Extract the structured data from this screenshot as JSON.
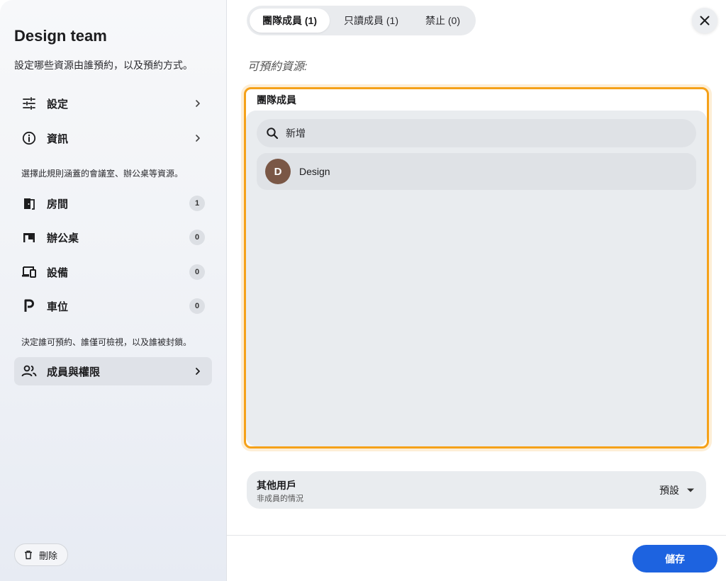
{
  "sidebar": {
    "title": "Design team",
    "subtitle": "設定哪些資源由誰預約，以及預約方式。",
    "items_top": [
      {
        "label": "設定",
        "icon": "sliders-icon"
      },
      {
        "label": "資訊",
        "icon": "info-icon"
      }
    ],
    "resources_note": "選擇此規則涵蓋的會議室、辦公桌等資源。",
    "resources": [
      {
        "label": "房間",
        "count": "1",
        "icon": "door-icon"
      },
      {
        "label": "辦公桌",
        "count": "0",
        "icon": "desk-icon"
      },
      {
        "label": "設備",
        "count": "0",
        "icon": "devices-icon"
      },
      {
        "label": "車位",
        "count": "0",
        "icon": "parking-icon"
      }
    ],
    "members_note": "決定誰可預約、誰僅可檢視，以及誰被封鎖。",
    "members_item": {
      "label": "成員與權限",
      "icon": "people-icon"
    },
    "delete_label": "刪除"
  },
  "tabs": [
    {
      "label": "團隊成員 (1)",
      "active": true
    },
    {
      "label": "只讀成員 (1)",
      "active": false
    },
    {
      "label": "禁止 (0)",
      "active": false
    }
  ],
  "main": {
    "resources_label": "可預約資源:",
    "panel_title": "團隊成員",
    "search_placeholder": "新增",
    "members": [
      {
        "initial": "D",
        "name": "Design",
        "avatar_color": "#7a5746"
      }
    ],
    "others": {
      "title": "其他用戶",
      "subtitle": "非成員的情況",
      "value": "預設"
    },
    "save_label": "儲存"
  },
  "colors": {
    "accent": "#1d63e0",
    "highlight": "#f5a119"
  }
}
